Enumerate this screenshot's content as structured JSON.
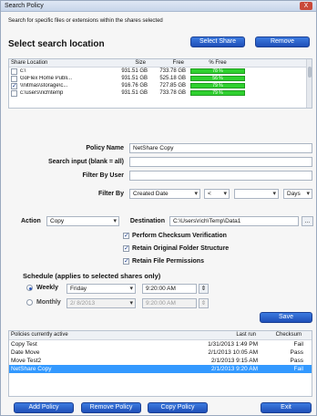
{
  "window": {
    "title": "Search Policy",
    "close_glyph": "X"
  },
  "intro_text": "Search for specific files or extensions within the shares selected",
  "select_location": {
    "heading": "Select search location",
    "select_share_label": "Select Share",
    "remove_label": "Remove"
  },
  "shares": {
    "columns": [
      "Share Location",
      "Size",
      "Free",
      "% Free"
    ],
    "rows": [
      {
        "location": "c:\\",
        "size": "931.51 GB",
        "free": "733.78 GB",
        "pct": "78 %",
        "checked": false
      },
      {
        "location": "GoFlex Home Publi...",
        "size": "931.51 GB",
        "free": "525.18 GB",
        "pct": "56 %",
        "checked": false
      },
      {
        "location": "\\\\nitmas\\storage\\c...",
        "size": "916.76 GB",
        "free": "727.85 GB",
        "pct": "79 %",
        "checked": true
      },
      {
        "location": "c:\\users\\rich\\temp",
        "size": "931.51 GB",
        "free": "733.78 GB",
        "pct": "79 %",
        "checked": false
      }
    ]
  },
  "form": {
    "policy_name_label": "Policy Name",
    "policy_name_value": "NetShare Copy",
    "search_input_label": "Search input (blank = all)",
    "search_input_value": "",
    "filter_user_label": "Filter By User",
    "filter_user_value": "",
    "filter_by_label": "Filter By",
    "filter_by_value": "Created Date",
    "operator_value": "<",
    "amount_value": "",
    "unit_value": "Days"
  },
  "action": {
    "label": "Action",
    "value": "Copy",
    "destination_label": "Destination",
    "destination_value": "C:\\Users\\rich\\Temp\\Data1",
    "browse_label": "..."
  },
  "options": {
    "checksum": "Perform Checksum Verification",
    "retain_structure": "Retain Original Folder Structure",
    "retain_permissions": "Retain File Permissions"
  },
  "schedule": {
    "heading": "Schedule (applies to selected shares only)",
    "weekly_label": "Weekly",
    "weekly_day": "Friday",
    "weekly_time": "9:20:00 AM",
    "monthly_label": "Monthly",
    "monthly_date": "2/ 8/2013",
    "monthly_time": "9:20:00 AM",
    "selected": "weekly"
  },
  "save_label": "Save",
  "policies": {
    "columns": [
      "Policies currently active",
      "Last run",
      "Checksum"
    ],
    "rows": [
      {
        "name": "Copy Test",
        "last_run": "1/31/2013 1:49 PM",
        "checksum": "Fail",
        "selected": false
      },
      {
        "name": "Date Move",
        "last_run": "2/1/2013 10:05 AM",
        "checksum": "Pass",
        "selected": false
      },
      {
        "name": "Move Test2",
        "last_run": "2/1/2013 9:15 AM",
        "checksum": "Pass",
        "selected": false
      },
      {
        "name": "NetShare Copy",
        "last_run": "2/1/2013 9:20 AM",
        "checksum": "Fail",
        "selected": true
      }
    ]
  },
  "footer": {
    "add_policy": "Add Policy",
    "remove_policy": "Remove Policy",
    "copy_policy": "Copy Policy",
    "exit": "Exit"
  },
  "colors": {
    "accent": "#2a5fcf",
    "progress": "#2fd12f",
    "selection": "#3399ff"
  }
}
